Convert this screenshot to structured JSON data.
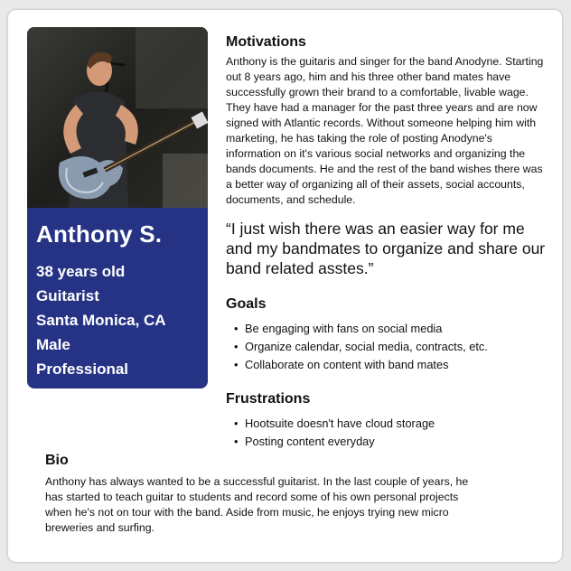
{
  "persona": {
    "name": "Anthony S.",
    "facts": [
      "38 years old",
      "Guitarist",
      "Santa Monica, CA",
      "Male",
      "Professional"
    ]
  },
  "motivations": {
    "heading": "Motivations",
    "text": "Anthony is the guitaris and singer for the band Anodyne. Starting out 8 years ago, him and his three other band mates have successfully grown their brand to a comfortable, livable wage. They have had a manager for the past three years and are now signed with Atlantic records. Without someone helping him with marketing, he has taking the role of posting Anodyne's information on it's various social networks and organizing the bands documents. He and the rest of the band wishes there was a better way of organizing all of their assets, social accounts, documents, and schedule."
  },
  "quote": "“I just wish there was an easier way for me and my bandmates to organize and share our band related asstes.”",
  "goals": {
    "heading": "Goals",
    "items": [
      "Be engaging with fans on social media",
      "Organize calendar, social media, contracts, etc.",
      "Collaborate on content with band mates"
    ]
  },
  "frustrations": {
    "heading": "Frustrations",
    "items": [
      "Hootsuite doesn't have cloud storage",
      "Posting content everyday"
    ]
  },
  "bio": {
    "heading": "Bio",
    "text": "Anthony has always wanted to be a successful guitarist. In the last couple of years, he has started to teach guitar to students and record some of his own personal projects when he's not on tour with the band. Aside from music, he enjoys trying new micro breweries and surfing."
  },
  "colors": {
    "profile_panel": "#263385",
    "card": "#ffffff",
    "background": "#e9e9e9"
  }
}
